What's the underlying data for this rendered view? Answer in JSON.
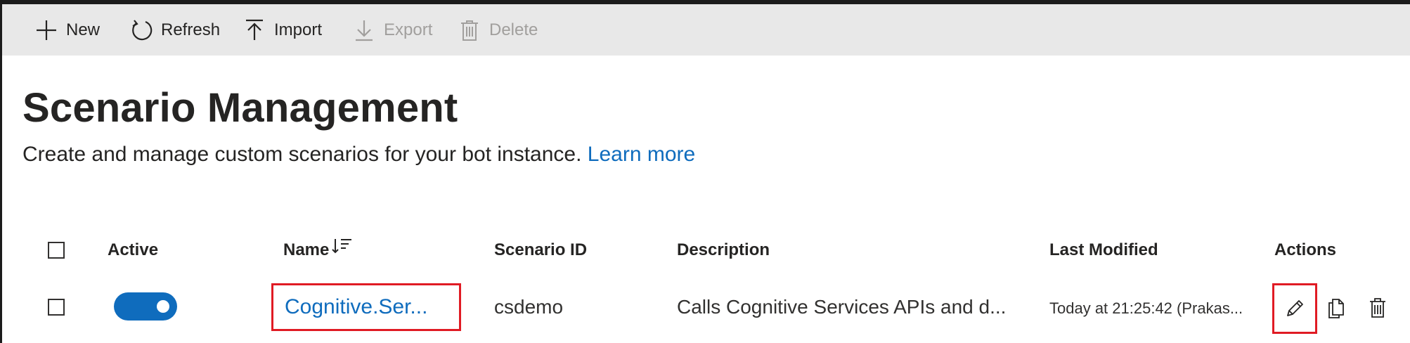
{
  "toolbar": {
    "new_label": "New",
    "refresh_label": "Refresh",
    "import_label": "Import",
    "export_label": "Export",
    "delete_label": "Delete"
  },
  "page": {
    "title": "Scenario Management",
    "subtitle": "Create and manage custom scenarios for your bot instance.",
    "learn_more": "Learn more"
  },
  "table": {
    "columns": {
      "active": "Active",
      "name": "Name",
      "scenario_id": "Scenario ID",
      "description": "Description",
      "last_modified": "Last Modified",
      "actions": "Actions"
    },
    "rows": [
      {
        "active": true,
        "name": "Cognitive.Ser...",
        "scenario_id": "csdemo",
        "description": "Calls Cognitive Services APIs and d...",
        "last_modified": "Today at 21:25:42 (Prakas..."
      }
    ]
  },
  "colors": {
    "accent": "#0f6cbd",
    "highlight_border": "#e01b24",
    "toolbar_bg": "#e8e8e8",
    "disabled_text": "#a19f9d"
  }
}
